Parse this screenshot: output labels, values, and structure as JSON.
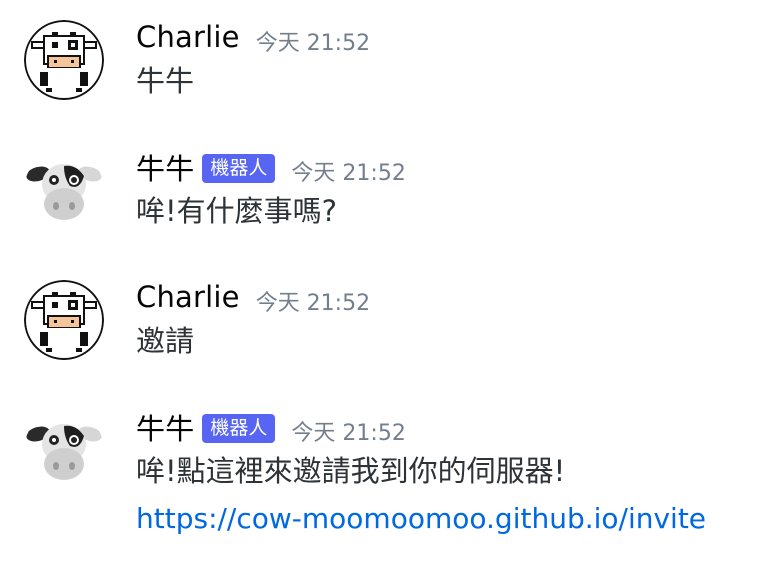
{
  "messages": [
    {
      "author": "Charlie",
      "is_bot": false,
      "bot_tag": "",
      "timestamp": "今天 21:52",
      "content": "牛牛",
      "link": "",
      "avatar_icon": "pixel-cow-avatar-icon"
    },
    {
      "author": "牛牛",
      "is_bot": true,
      "bot_tag": "機器人",
      "timestamp": "今天 21:52",
      "content": "哞!有什麼事嗎?",
      "link": "",
      "avatar_icon": "plush-cow-avatar-icon"
    },
    {
      "author": "Charlie",
      "is_bot": false,
      "bot_tag": "",
      "timestamp": "今天 21:52",
      "content": "邀請",
      "link": "",
      "avatar_icon": "pixel-cow-avatar-icon"
    },
    {
      "author": "牛牛",
      "is_bot": true,
      "bot_tag": "機器人",
      "timestamp": "今天 21:52",
      "content": "哞!點這裡來邀請我到你的伺服器!",
      "link": "https://cow-moomoomoo.github.io/invite",
      "avatar_icon": "plush-cow-avatar-icon"
    }
  ],
  "colors": {
    "bot_tag_bg": "#5865f2",
    "link": "#0068e0",
    "timestamp": "#747f8d",
    "username": "#060607"
  }
}
